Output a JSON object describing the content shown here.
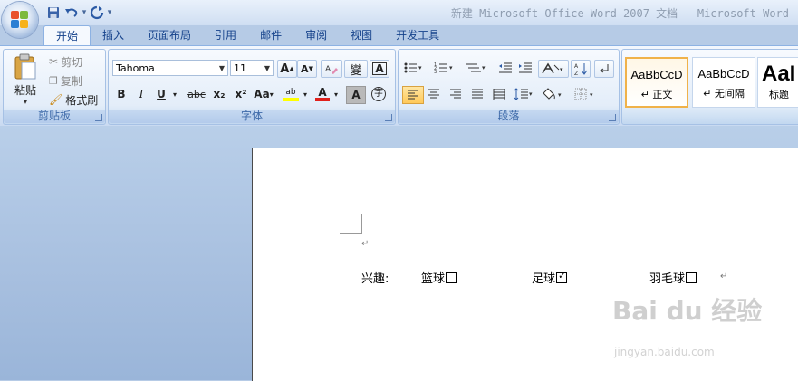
{
  "window": {
    "title": "新建 Microsoft Office Word 2007 文档 - Microsoft Word"
  },
  "colors": {
    "ribbon_blue": "#15428b",
    "workspace_blue": "#a7bfdf",
    "selected_style_border": "#f0b24a"
  },
  "quick_access": {
    "icons": [
      "save-icon",
      "undo-icon",
      "redo-icon",
      "customize-icon"
    ]
  },
  "tabs": [
    {
      "label": "开始",
      "active": true
    },
    {
      "label": "插入"
    },
    {
      "label": "页面布局"
    },
    {
      "label": "引用"
    },
    {
      "label": "邮件"
    },
    {
      "label": "审阅"
    },
    {
      "label": "视图"
    },
    {
      "label": "开发工具"
    }
  ],
  "clipboard": {
    "group_label": "剪贴板",
    "paste_label": "粘贴",
    "cut_label": "剪切",
    "copy_label": "复制",
    "format_painter_label": "格式刷"
  },
  "font": {
    "group_label": "字体",
    "font_name": "Tahoma",
    "font_size": "11",
    "grow_label": "A",
    "shrink_label": "A",
    "phonetic_label": "變",
    "border_label": "A",
    "bold": "B",
    "italic": "I",
    "underline": "U",
    "strike": "abc",
    "subscript": "x₂",
    "superscript": "x²",
    "change_case": "Aa",
    "highlight": "ab",
    "font_color": "A",
    "shading": "A",
    "enclose": "字"
  },
  "paragraph": {
    "group_label": "段落"
  },
  "styles": {
    "items": [
      {
        "sample": "AaBbCcD",
        "name": "↵ 正文",
        "selected": true
      },
      {
        "sample": "AaBbCcD",
        "name": "↵ 无间隔"
      },
      {
        "sample": "AaI",
        "name": "标题"
      }
    ]
  },
  "document": {
    "para_mark": "↵",
    "line_label": "兴趣:",
    "options": [
      {
        "label": "篮球",
        "checked": false
      },
      {
        "label": "足球",
        "checked": true
      },
      {
        "label": "羽毛球",
        "checked": false
      }
    ],
    "end_mark": "↵"
  },
  "watermark": {
    "brand": "Bai du 经验",
    "url": "jingyan.baidu.com"
  }
}
